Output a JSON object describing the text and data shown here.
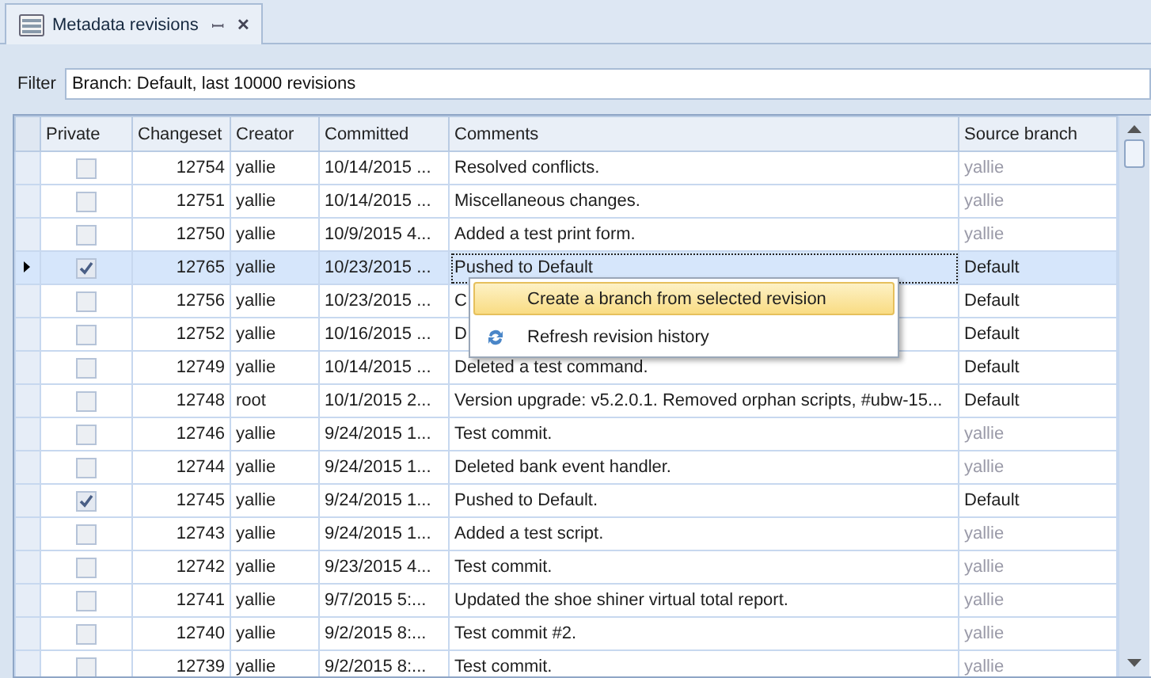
{
  "tab": {
    "title": "Metadata revisions",
    "pin": "ꟷ",
    "close": "✕"
  },
  "filter": {
    "label": "Filter",
    "value": "Branch: Default, last 10000 revisions"
  },
  "table": {
    "columns": [
      "Private",
      "Changeset",
      "Creator",
      "Committed",
      "Comments",
      "Source branch"
    ],
    "rows": [
      {
        "private": false,
        "changeset": "12754",
        "creator": "yallie",
        "committed": "10/14/2015 ...",
        "comments": "Resolved conflicts.",
        "source": "yallie",
        "source_muted": true,
        "selected": false
      },
      {
        "private": false,
        "changeset": "12751",
        "creator": "yallie",
        "committed": "10/14/2015 ...",
        "comments": "Miscellaneous changes.",
        "source": "yallie",
        "source_muted": true,
        "selected": false
      },
      {
        "private": false,
        "changeset": "12750",
        "creator": "yallie",
        "committed": "10/9/2015 4...",
        "comments": "Added a test print form.",
        "source": "yallie",
        "source_muted": true,
        "selected": false
      },
      {
        "private": true,
        "changeset": "12765",
        "creator": "yallie",
        "committed": "10/23/2015 ...",
        "comments": "Pushed to Default",
        "source": "Default",
        "source_muted": false,
        "selected": true
      },
      {
        "private": false,
        "changeset": "12756",
        "creator": "yallie",
        "committed": "10/23/2015 ...",
        "comments": "C",
        "source": "Default",
        "source_muted": false,
        "selected": false
      },
      {
        "private": false,
        "changeset": "12752",
        "creator": "yallie",
        "committed": "10/16/2015 ...",
        "comments": "D",
        "source": "Default",
        "source_muted": false,
        "selected": false
      },
      {
        "private": false,
        "changeset": "12749",
        "creator": "yallie",
        "committed": "10/14/2015 ...",
        "comments": "Deleted a test command.",
        "source": "Default",
        "source_muted": false,
        "selected": false
      },
      {
        "private": false,
        "changeset": "12748",
        "creator": "root",
        "committed": "10/1/2015 2...",
        "comments": "Version upgrade: v5.2.0.1. Removed orphan scripts, #ubw-15...",
        "source": "Default",
        "source_muted": false,
        "selected": false
      },
      {
        "private": false,
        "changeset": "12746",
        "creator": "yallie",
        "committed": "9/24/2015 1...",
        "comments": "Test commit.",
        "source": "yallie",
        "source_muted": true,
        "selected": false
      },
      {
        "private": false,
        "changeset": "12744",
        "creator": "yallie",
        "committed": "9/24/2015 1...",
        "comments": "Deleted bank event handler.",
        "source": "yallie",
        "source_muted": true,
        "selected": false
      },
      {
        "private": true,
        "changeset": "12745",
        "creator": "yallie",
        "committed": "9/24/2015 1...",
        "comments": "Pushed to Default.",
        "source": "Default",
        "source_muted": false,
        "selected": false
      },
      {
        "private": false,
        "changeset": "12743",
        "creator": "yallie",
        "committed": "9/24/2015 1...",
        "comments": "Added a test script.",
        "source": "yallie",
        "source_muted": true,
        "selected": false
      },
      {
        "private": false,
        "changeset": "12742",
        "creator": "yallie",
        "committed": "9/23/2015 4...",
        "comments": "Test commit.",
        "source": "yallie",
        "source_muted": true,
        "selected": false
      },
      {
        "private": false,
        "changeset": "12741",
        "creator": "yallie",
        "committed": "9/7/2015 5:...",
        "comments": "Updated the shoe shiner virtual total report.",
        "source": "yallie",
        "source_muted": true,
        "selected": false
      },
      {
        "private": false,
        "changeset": "12740",
        "creator": "yallie",
        "committed": "9/2/2015 8:...",
        "comments": "Test commit #2.",
        "source": "yallie",
        "source_muted": true,
        "selected": false
      },
      {
        "private": false,
        "changeset": "12739",
        "creator": "yallie",
        "committed": "9/2/2015 8:...",
        "comments": "Test commit.",
        "source": "yallie",
        "source_muted": true,
        "selected": false
      }
    ]
  },
  "context_menu": {
    "items": [
      {
        "label": "Create a branch from selected revision",
        "selected": true,
        "kind": "plain"
      },
      {
        "label": "Refresh revision history",
        "selected": false,
        "kind": "refresh"
      }
    ]
  }
}
